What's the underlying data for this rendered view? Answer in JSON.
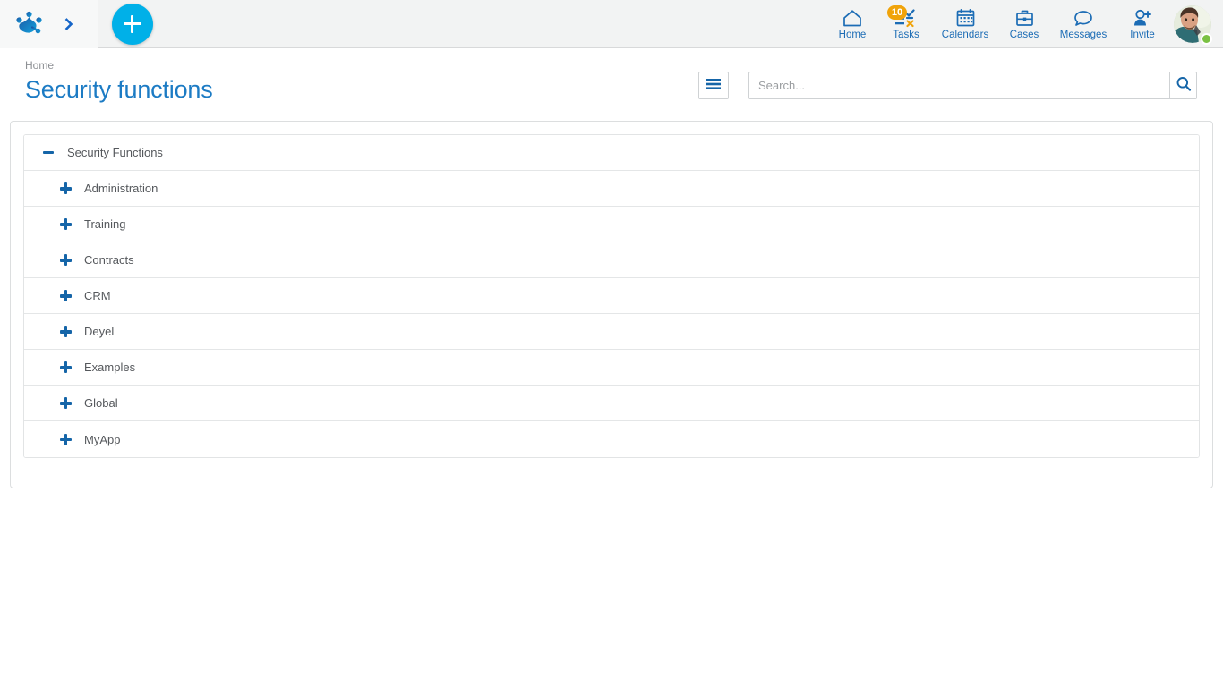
{
  "app": {
    "logo_icon": "deyel-paw-logo",
    "expand_icon": "chevron-right-icon",
    "create_label": "+",
    "create_icon": "plus-icon"
  },
  "colors": {
    "brand_blue": "#1c7bc4",
    "nav_blue": "#1c6cb5",
    "accent_cyan": "#00b0e8",
    "badge_orange": "#f0a30a",
    "status_green": "#7ac143",
    "header_bg": "#f2f3f3",
    "text_gray": "#55585c",
    "border_gray": "#dcdedf"
  },
  "topnav": {
    "items": [
      {
        "label": "Home",
        "icon": "home-icon",
        "badge": null
      },
      {
        "label": "Tasks",
        "icon": "tasks-checklist-icon",
        "badge": "10"
      },
      {
        "label": "Calendars",
        "icon": "calendar-icon",
        "badge": null
      },
      {
        "label": "Cases",
        "icon": "briefcase-icon",
        "badge": null
      },
      {
        "label": "Messages",
        "icon": "chat-bubble-icon",
        "badge": null
      },
      {
        "label": "Invite",
        "icon": "user-plus-icon",
        "badge": null
      }
    ],
    "avatar": {
      "icon": "user-avatar",
      "status": "online"
    }
  },
  "page": {
    "breadcrumb": "Home",
    "title": "Security functions"
  },
  "toolbar": {
    "menu_icon": "hamburger-menu-icon",
    "search": {
      "placeholder": "Search...",
      "value": "",
      "button_icon": "search-icon"
    }
  },
  "tree": {
    "nodes": [
      {
        "label": "Security Functions",
        "level": 0,
        "state": "expanded",
        "icon": "minus-icon"
      },
      {
        "label": "Administration",
        "level": 1,
        "state": "collapsed",
        "icon": "plus-icon"
      },
      {
        "label": "Training",
        "level": 1,
        "state": "collapsed",
        "icon": "plus-icon"
      },
      {
        "label": "Contracts",
        "level": 1,
        "state": "collapsed",
        "icon": "plus-icon"
      },
      {
        "label": "CRM",
        "level": 1,
        "state": "collapsed",
        "icon": "plus-icon"
      },
      {
        "label": "Deyel",
        "level": 1,
        "state": "collapsed",
        "icon": "plus-icon"
      },
      {
        "label": "Examples",
        "level": 1,
        "state": "collapsed",
        "icon": "plus-icon"
      },
      {
        "label": "Global",
        "level": 1,
        "state": "collapsed",
        "icon": "plus-icon"
      },
      {
        "label": "MyApp",
        "level": 1,
        "state": "collapsed",
        "icon": "plus-icon"
      }
    ]
  }
}
